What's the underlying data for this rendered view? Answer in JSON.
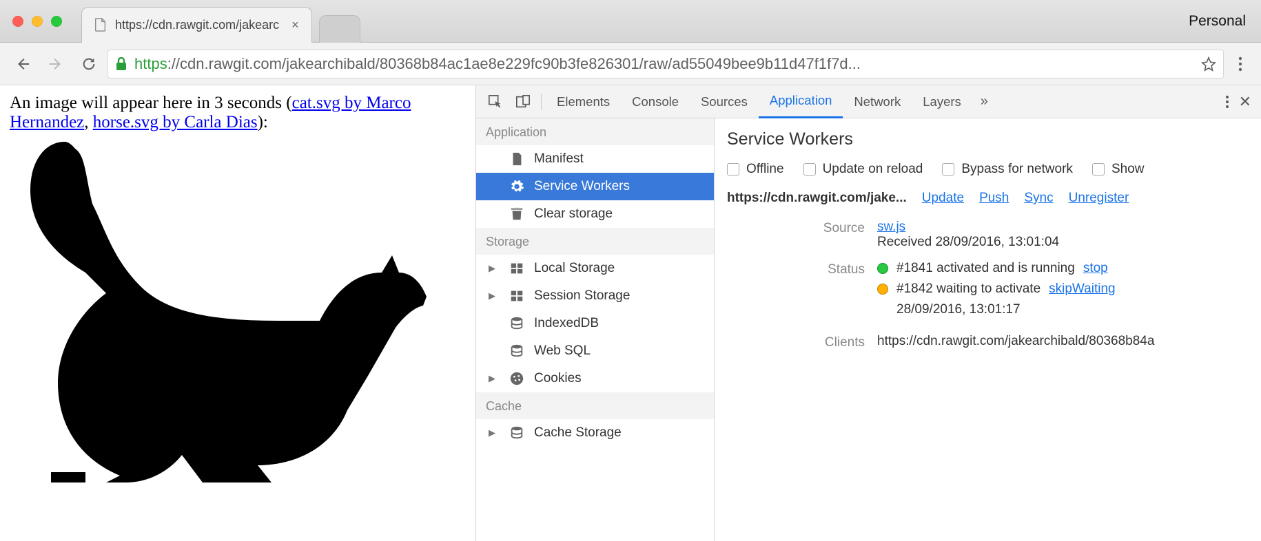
{
  "window": {
    "profile_label": "Personal",
    "tab_title": "https://cdn.rawgit.com/jakearc"
  },
  "address": {
    "secure_prefix": "https",
    "rest": "://cdn.rawgit.com/jakearchibald/80368b84ac1ae8e229fc90b3fe826301/raw/ad55049bee9b11d47f1f7d..."
  },
  "page": {
    "before": "An image will appear here in 3 seconds (",
    "link1": "cat.svg by Marco Hernandez",
    "mid": ", ",
    "link2": "horse.svg by Carla Dias",
    "after": "):"
  },
  "devtools": {
    "tabs": [
      "Elements",
      "Console",
      "Sources",
      "Application",
      "Network",
      "Layers"
    ],
    "active_tab": "Application",
    "sidebar": {
      "groups": [
        {
          "title": "Application",
          "items": [
            "Manifest",
            "Service Workers",
            "Clear storage"
          ],
          "selected": "Service Workers"
        },
        {
          "title": "Storage",
          "items": [
            "Local Storage",
            "Session Storage",
            "IndexedDB",
            "Web SQL",
            "Cookies"
          ]
        },
        {
          "title": "Cache",
          "items": [
            "Cache Storage"
          ]
        }
      ]
    },
    "sw": {
      "heading": "Service Workers",
      "checks": [
        "Offline",
        "Update on reload",
        "Bypass for network",
        "Show"
      ],
      "origin": "https://cdn.rawgit.com/jake...",
      "actions": [
        "Update",
        "Push",
        "Sync",
        "Unregister"
      ],
      "labels": {
        "source": "Source",
        "status": "Status",
        "clients": "Clients"
      },
      "source_link": "sw.js",
      "source_received": "Received 28/09/2016, 13:01:04",
      "status1_text": "#1841 activated and is running",
      "status1_action": "stop",
      "status2_text": "#1842 waiting to activate",
      "status2_action": "skipWaiting",
      "status2_time": "28/09/2016, 13:01:17",
      "clients_text": "https://cdn.rawgit.com/jakearchibald/80368b84a"
    }
  }
}
